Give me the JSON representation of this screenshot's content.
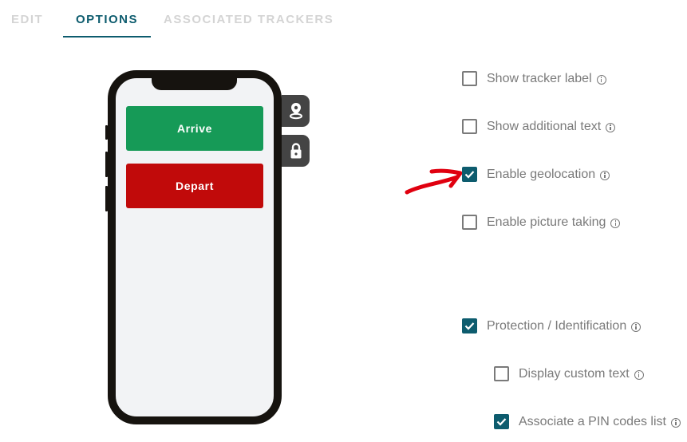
{
  "tabs": [
    {
      "label": "EDIT",
      "active": false
    },
    {
      "label": "OPTIONS",
      "active": true
    },
    {
      "label": "ASSOCIATED TRACKERS",
      "active": false
    }
  ],
  "phone": {
    "buttons": [
      {
        "label": "Arrive",
        "color": "#169a57"
      },
      {
        "label": "Depart",
        "color": "#c10a0a"
      }
    ],
    "side_icons": [
      "location-pin-icon",
      "lock-icon"
    ]
  },
  "options": [
    {
      "label": "Show tracker label",
      "checked": false
    },
    {
      "label": "Show additional text",
      "checked": false
    },
    {
      "label": "Enable geolocation",
      "checked": true
    },
    {
      "label": "Enable picture taking",
      "checked": false
    },
    {
      "label": "Protection / Identification",
      "checked": true
    },
    {
      "label": "Display custom text",
      "checked": false
    },
    {
      "label": "Associate a PIN codes list",
      "checked": true
    }
  ],
  "colors": {
    "accent": "#0d5c6e",
    "annotation": "#e0000f"
  }
}
